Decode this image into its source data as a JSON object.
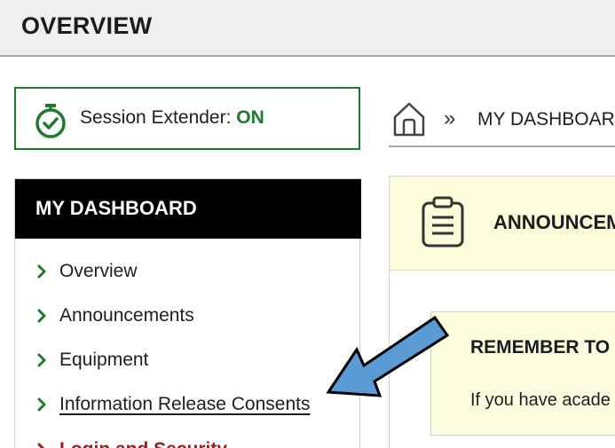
{
  "header": {
    "title": "OVERVIEW"
  },
  "session": {
    "label": "Session Extender: ",
    "status": "ON",
    "icon": "stopwatch-icon"
  },
  "sidebar": {
    "title": "MY DASHBOARD",
    "items": [
      {
        "label": "Overview"
      },
      {
        "label": "Announcements"
      },
      {
        "label": "Equipment"
      },
      {
        "label": "Information Release Consents"
      },
      {
        "label": "Login and Security"
      }
    ]
  },
  "breadcrumb": {
    "separator": "»",
    "current": "MY DASHBOARD",
    "icon": "home-icon"
  },
  "announcements": {
    "title": "ANNOUNCEMENTS",
    "icon": "clipboard-icon",
    "notice": {
      "title": "REMEMBER TO R",
      "body": "If you have acade"
    }
  },
  "colors": {
    "accent_green": "#1f7a2e",
    "active_red": "#9b1c1c",
    "announce_bg": "#fcfcda",
    "arrow_blue": "#5b9bd5"
  }
}
